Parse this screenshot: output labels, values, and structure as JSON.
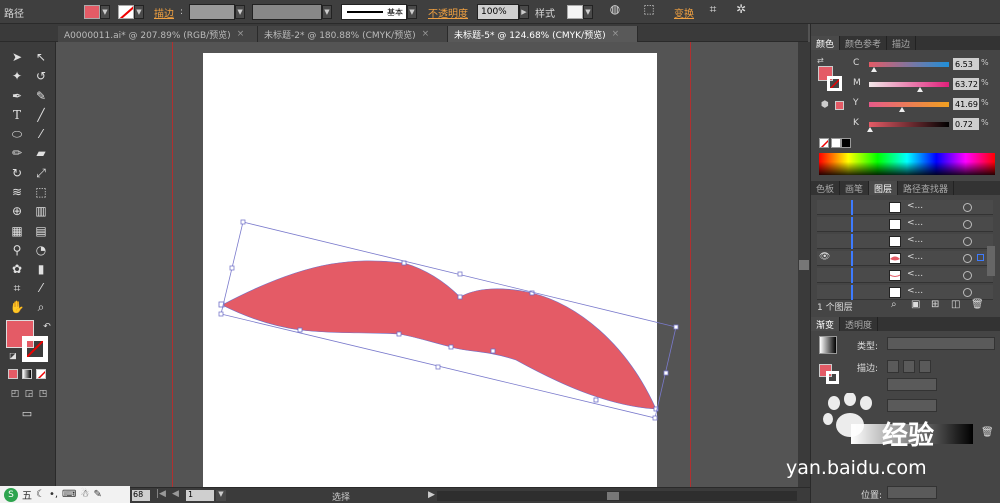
{
  "control_bar": {
    "mode_label": "路径",
    "fill_color": "#e45b66",
    "stroke_label": "描边",
    "stroke_style_label": "基本",
    "opacity_label": "不透明度",
    "opacity_value": "100%",
    "style_label": "样式",
    "transform_label": "变换"
  },
  "doc_tabs": [
    {
      "label": "A0000011.ai* @ 207.89% (RGB/预览)"
    },
    {
      "label": "未标题-2* @ 180.88% (CMYK/预览)"
    },
    {
      "label": "未标题-5* @ 124.68% (CMYK/预览)"
    }
  ],
  "tools": {
    "text_tool_glyph": "T",
    "taskbar_char": "五"
  },
  "color_panel": {
    "tabs": [
      "颜色",
      "颜色参考",
      "描边"
    ],
    "channels": [
      {
        "letter": "C",
        "value": "6.53",
        "unit": "%",
        "level": 0.065
      },
      {
        "letter": "M",
        "value": "63.72",
        "unit": "%",
        "level": 0.637
      },
      {
        "letter": "Y",
        "value": "41.69",
        "unit": "%",
        "level": 0.417
      },
      {
        "letter": "K",
        "value": "0.72",
        "unit": "%",
        "level": 0.007
      }
    ],
    "fill_color": "#e45b66"
  },
  "layers_panel": {
    "tabs": [
      "色板",
      "画笔",
      "图层",
      "路径查找器"
    ],
    "rows": [
      {
        "name": "<...",
        "visible": false
      },
      {
        "name": "<...",
        "visible": false
      },
      {
        "name": "<...",
        "visible": false
      },
      {
        "name": "<...",
        "visible": true
      },
      {
        "name": "<...",
        "visible": false
      },
      {
        "name": "<...",
        "visible": false
      }
    ],
    "count_label": "1 个图层"
  },
  "gradient_panel": {
    "tabs": [
      "渐变",
      "透明度"
    ],
    "type_label": "类型:",
    "stroke_label": "描边:",
    "position_label": "位置:"
  },
  "status_bar": {
    "zoom_value": "68",
    "page_value": "1",
    "tool_label": "选择"
  },
  "watermark": {
    "brand": "经验",
    "url": "yan.baidu.com"
  }
}
